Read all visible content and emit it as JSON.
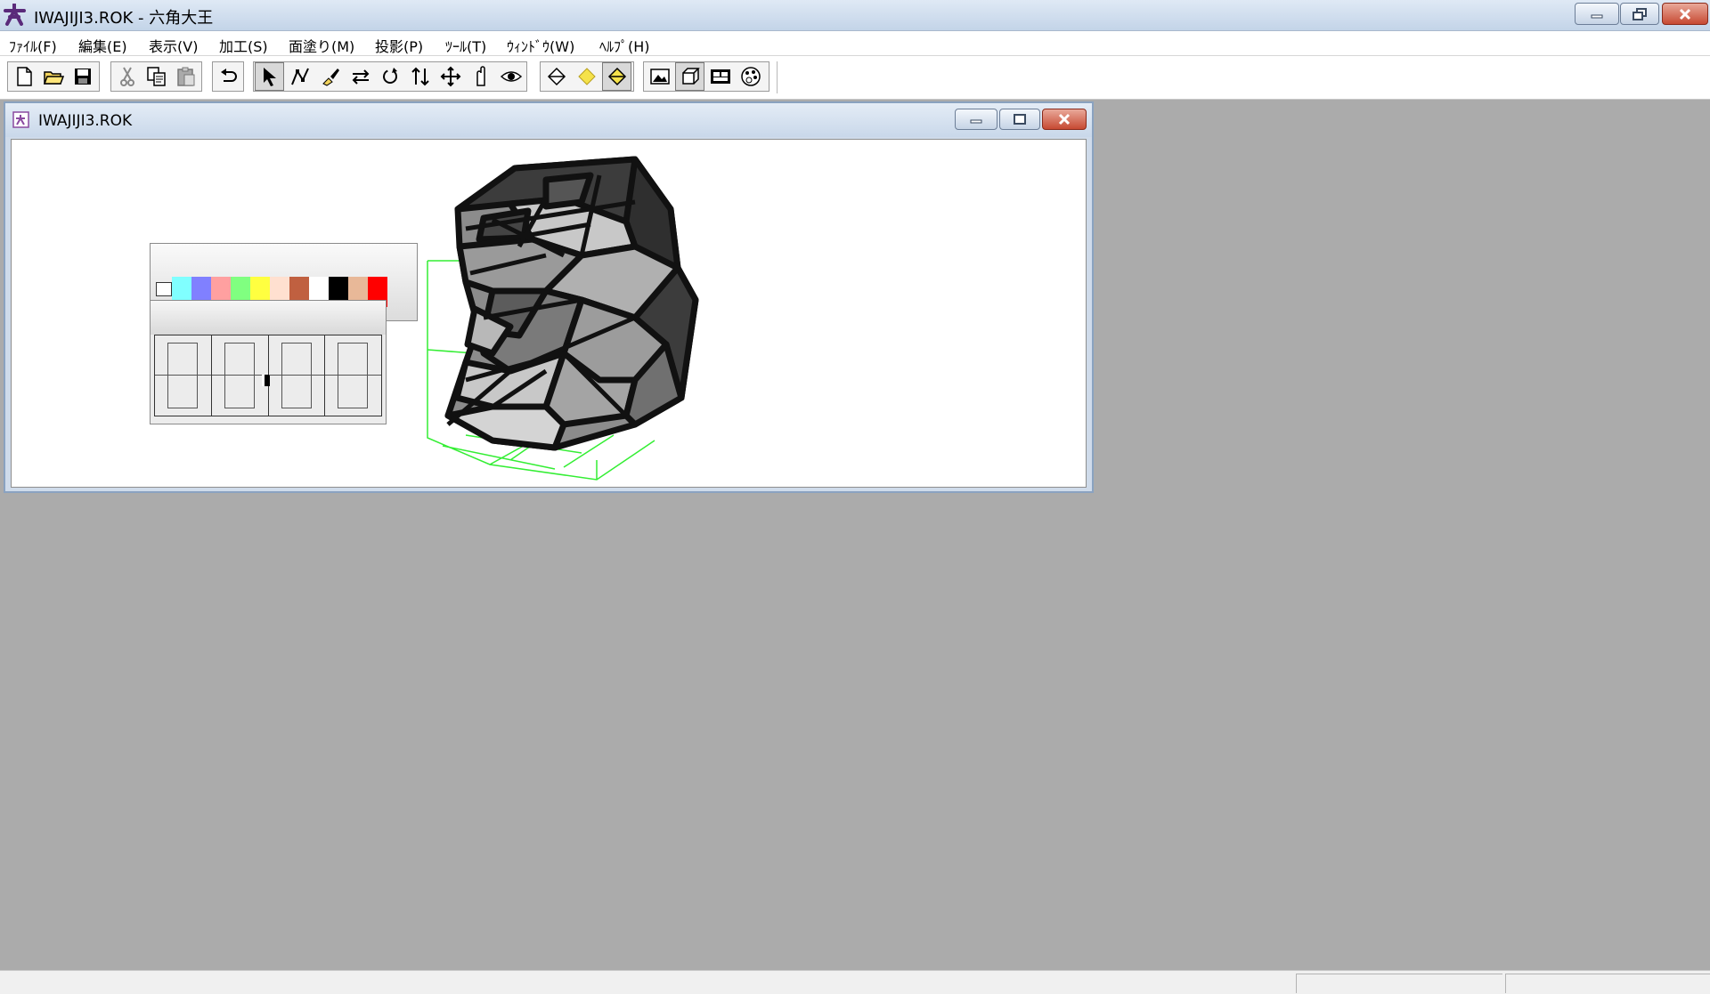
{
  "window": {
    "title": "IWAJIJI3.ROK - 六角大王",
    "brand_color": "#5a2a7a"
  },
  "menu": [
    {
      "label": "ﾌｧｲﾙ(F)"
    },
    {
      "label": "編集(E)"
    },
    {
      "label": "表示(V)"
    },
    {
      "label": "加工(S)"
    },
    {
      "label": "面塗り(M)"
    },
    {
      "label": "投影(P)"
    },
    {
      "label": "ﾂｰﾙ(T)"
    },
    {
      "label": "ｳｨﾝﾄﾞｳ(W)"
    },
    {
      "label": "ﾍﾙﾌﾟ(H)"
    }
  ],
  "toolbar": {
    "buttons": [
      {
        "icon": "new-file-icon"
      },
      {
        "icon": "open-folder-icon"
      },
      {
        "icon": "save-icon"
      },
      {
        "icon": "cut-icon"
      },
      {
        "icon": "copy-icon"
      },
      {
        "icon": "paste-icon"
      },
      {
        "icon": "undo-icon"
      },
      {
        "icon": "select-arrow-icon",
        "pressed": true
      },
      {
        "icon": "polyline-icon"
      },
      {
        "icon": "paint-brush-icon"
      },
      {
        "icon": "flip-icon"
      },
      {
        "icon": "rotate-icon"
      },
      {
        "icon": "scale-icon"
      },
      {
        "icon": "move-icon"
      },
      {
        "icon": "hand-icon"
      },
      {
        "icon": "eye-icon"
      },
      {
        "icon": "diamond-outline-icon"
      },
      {
        "icon": "diamond-yellow-icon"
      },
      {
        "icon": "diamond-half-icon",
        "pressed": true
      },
      {
        "icon": "image-icon"
      },
      {
        "icon": "cube-icon"
      },
      {
        "icon": "texture-icon"
      },
      {
        "icon": "palette-icon"
      }
    ]
  },
  "document": {
    "title": "IWAJIJI3.ROK"
  },
  "palette": {
    "swatches": [
      "#ffffff",
      "#80ffff",
      "#8080ff",
      "#ffa0a0",
      "#80ff80",
      "#ffff40",
      "#ffe0d0",
      "#c06040",
      "#ffffff",
      "#000000",
      "#e8b898",
      "#ff0000"
    ]
  },
  "colors": {
    "mesh_light": "#c8c8c8",
    "mesh_mid": "#8c8c8c",
    "mesh_dark": "#3c3c3c",
    "bounding_box": "#33ee33"
  }
}
